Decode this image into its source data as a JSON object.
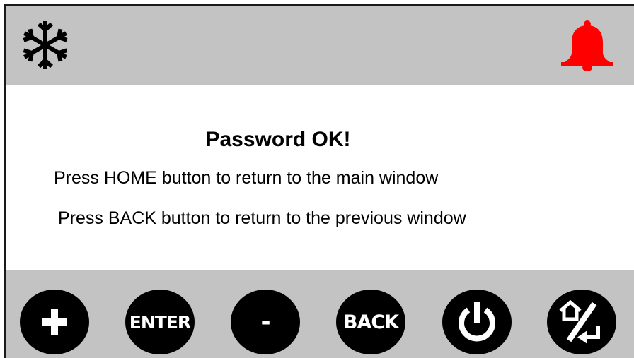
{
  "header": {
    "left_icon": "snowflake-icon",
    "right_icon": "bell-icon",
    "alarm_color": "#ff0000"
  },
  "message": {
    "title": "Password OK!",
    "line1": "Press HOME button to return to the main window",
    "line2": "Press BACK button to return to the previous window"
  },
  "buttons": {
    "plus_icon": "plus-icon",
    "enter_label": "ENTER",
    "minus_label": "-",
    "back_label": "BACK",
    "power_icon": "power-icon",
    "home_back_icon": "home-back-icon"
  }
}
